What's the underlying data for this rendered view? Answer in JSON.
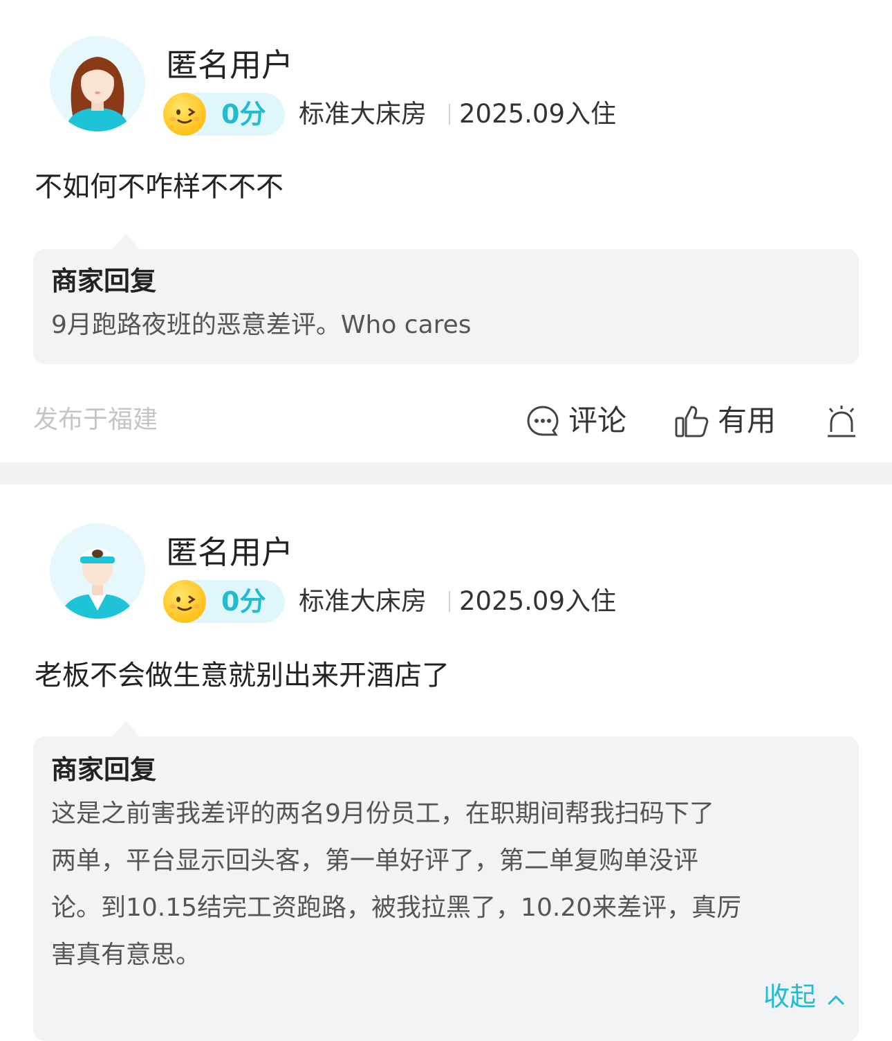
{
  "reviews": [
    {
      "user_name": "匿名用户",
      "avatar_icon": "female-avatar-icon",
      "score": "0分",
      "room_type": "标准大床房",
      "checkin": "2025.09入住",
      "content": "不如何不咋样不不不",
      "reply": {
        "title": "商家回复",
        "text": "9月跑路夜班的恶意差评。Who cares"
      },
      "location": "发布于福建",
      "actions": {
        "comment_label": "评论",
        "helpful_label": "有用"
      }
    },
    {
      "user_name": "匿名用户",
      "avatar_icon": "male-avatar-icon",
      "score": "0分",
      "room_type": "标准大床房",
      "checkin": "2025.09入住",
      "content": "老板不会做生意就别出来开酒店了",
      "reply": {
        "title": "商家回复",
        "lines": [
          "这是之前害我差评的两名9月份员工，在职期间帮我扫码下了",
          "两单，平台显示回头客，第一单好评了，第二单复购单没评",
          "论。到10.15结完工资跑路，被我拉黑了，10.20来差评，真厉",
          "害真有意思。"
        ],
        "collapse_label": "收起"
      }
    }
  ],
  "colors": {
    "accent": "#1fbcd2",
    "reply_bg": "#f2f3f5",
    "divider": "#f2f2f2",
    "muted_text": "#c5c5c5"
  }
}
